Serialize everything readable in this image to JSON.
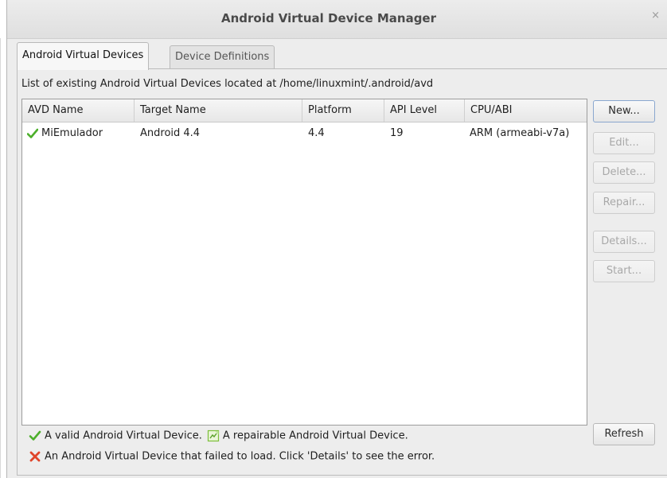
{
  "window": {
    "title": "Android Virtual Device Manager",
    "close_glyph": "×"
  },
  "tabs": [
    {
      "label": "Android Virtual Devices",
      "active": true
    },
    {
      "label": "Device Definitions",
      "active": false
    }
  ],
  "list_description": "List of existing Android Virtual Devices located at /home/linuxmint/.android/avd",
  "table": {
    "columns": [
      "AVD Name",
      "Target Name",
      "Platform",
      "API Level",
      "CPU/ABI"
    ],
    "rows": [
      {
        "status_icon": "valid-check-icon",
        "avd_name": "MiEmulador",
        "target_name": "Android 4.4",
        "platform": "4.4",
        "api_level": "19",
        "cpu_abi": "ARM (armeabi-v7a)"
      }
    ]
  },
  "buttons": {
    "new": "New...",
    "edit": "Edit...",
    "delete": "Delete...",
    "repair": "Repair...",
    "details": "Details...",
    "start": "Start...",
    "refresh": "Refresh"
  },
  "legend": {
    "valid": "A valid Android Virtual Device.",
    "repairable": "A repairable Android Virtual Device.",
    "failed": "An Android Virtual Device that failed to load. Click 'Details' to see the error."
  },
  "colors": {
    "valid_green": "#4caf2a",
    "error_red": "#e0452a",
    "window_bg": "#ededed"
  }
}
